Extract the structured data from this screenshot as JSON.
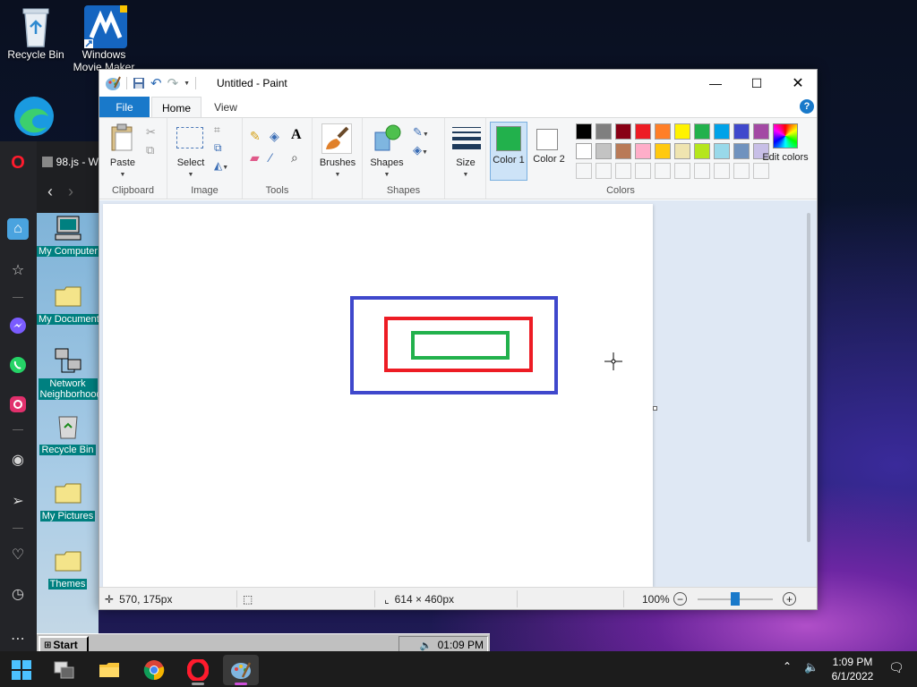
{
  "desktop": {
    "icons": [
      {
        "label": "Recycle Bin",
        "icon": "recycle-bin-icon"
      },
      {
        "label": "Windows Movie Maker",
        "icon": "movie-maker-icon"
      }
    ]
  },
  "opera": {
    "tab_title": "98.js - W",
    "rail": [
      "home-icon",
      "star-icon",
      "messenger-icon",
      "whatsapp-icon",
      "instagram-icon",
      "player-icon",
      "send-icon",
      "heart-icon",
      "history-icon",
      "more-icon"
    ]
  },
  "win98": {
    "icons": [
      {
        "label": "My Computer"
      },
      {
        "label": "My Documents"
      },
      {
        "label": "Network Neighborhood"
      },
      {
        "label": "Recycle Bin"
      },
      {
        "label": "My Pictures"
      },
      {
        "label": "Themes"
      }
    ],
    "start_label": "Start",
    "tray_time": "01:09 PM"
  },
  "paint": {
    "title": "Untitled - Paint",
    "tabs": {
      "file": "File",
      "home": "Home",
      "view": "View"
    },
    "help": "?",
    "ribbon": {
      "clipboard": {
        "paste": "Paste",
        "group": "Clipboard"
      },
      "image": {
        "select": "Select",
        "group": "Image"
      },
      "tools": {
        "group": "Tools"
      },
      "brushes": {
        "label": "Brushes"
      },
      "shapes": {
        "label": "Shapes",
        "group": "Shapes"
      },
      "size": {
        "label": "Size"
      },
      "color1": {
        "label": "Color 1",
        "value": "#22b14c"
      },
      "color2": {
        "label": "Color 2",
        "value": "#ffffff"
      },
      "colors_group": "Colors",
      "edit_colors": "Edit colors",
      "palette_row1": [
        "#000000",
        "#7f7f7f",
        "#880015",
        "#ed1c24",
        "#ff7f27",
        "#fff200",
        "#22b14c",
        "#00a2e8",
        "#3f48cc",
        "#a349a4"
      ],
      "palette_row2": [
        "#ffffff",
        "#c3c3c3",
        "#b97a57",
        "#ffaec9",
        "#ffc90e",
        "#efe4b0",
        "#b5e61d",
        "#99d9ea",
        "#7092be",
        "#c8bfe7"
      ]
    },
    "status": {
      "cursor_pos": "570, 175px",
      "canvas_size": "614 × 460px",
      "zoom": "100%"
    }
  },
  "taskbar": {
    "time": "1:09 PM",
    "date": "6/1/2022",
    "apps": [
      "start-icon",
      "task-view-icon",
      "file-explorer-icon",
      "chrome-icon",
      "opera-icon",
      "paint-icon"
    ]
  }
}
